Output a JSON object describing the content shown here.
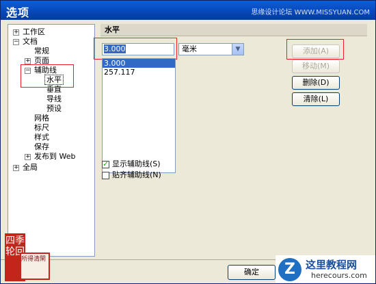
{
  "window": {
    "title": "选项",
    "watermark": "思缘设计论坛 WWW.MISSYUAN.COM"
  },
  "tree": {
    "items": [
      {
        "label": "工作区",
        "expander": "+"
      },
      {
        "label": "文档",
        "expander": "-"
      },
      {
        "label": "常规",
        "expander": ""
      },
      {
        "label": "页面",
        "expander": "+"
      },
      {
        "label": "辅助线",
        "expander": "-"
      },
      {
        "label": "水平",
        "expander": ""
      },
      {
        "label": "垂直",
        "expander": ""
      },
      {
        "label": "导线",
        "expander": ""
      },
      {
        "label": "预设",
        "expander": ""
      },
      {
        "label": "网格",
        "expander": ""
      },
      {
        "label": "标尺",
        "expander": ""
      },
      {
        "label": "样式",
        "expander": ""
      },
      {
        "label": "保存",
        "expander": ""
      },
      {
        "label": "发布到 Web",
        "expander": "+"
      },
      {
        "label": "全局",
        "expander": "+"
      }
    ]
  },
  "panel": {
    "heading": "水平",
    "value_input": "3.000",
    "unit_select": "毫米",
    "guides_list": [
      "3.000",
      "257.117"
    ],
    "buttons": {
      "add": "添加(A)",
      "move": "移动(M)",
      "delete": "删除(D)",
      "clear": "清除(L)"
    },
    "show_guides": {
      "label": "显示辅助线(S)",
      "checked": true
    },
    "snap_guides": {
      "label": "贴齐辅助线(N)",
      "checked": false
    }
  },
  "footer": {
    "ok_label": "确定",
    "stamp_text": "四季轮回",
    "seal_text": "所得清閑",
    "site_title": "这里教程网",
    "site_url": "herecours.com",
    "site_letter": "Z"
  }
}
